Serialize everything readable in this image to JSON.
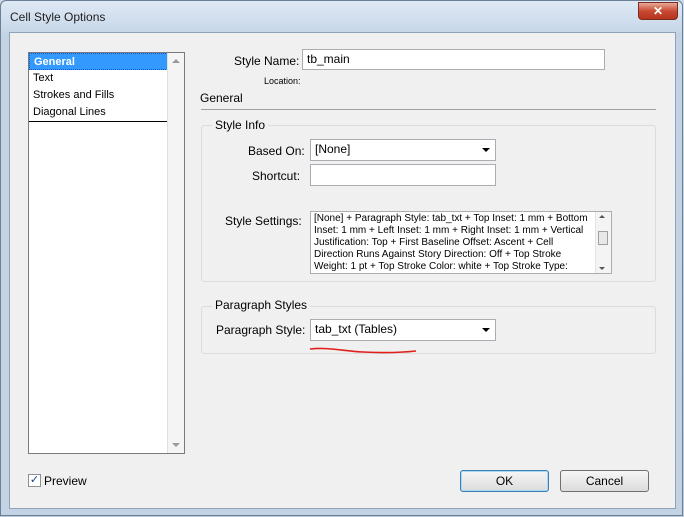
{
  "window": {
    "title": "Cell Style Options",
    "close_glyph": "✕"
  },
  "categories": [
    {
      "label": "General",
      "selected": true
    },
    {
      "label": "Text",
      "selected": false
    },
    {
      "label": "Strokes and Fills",
      "selected": false
    },
    {
      "label": "Diagonal Lines",
      "selected": false
    }
  ],
  "style_name": {
    "label": "Style Name:",
    "value": "tb_main"
  },
  "location": {
    "label": "Location:"
  },
  "section_title": "General",
  "style_info": {
    "title": "Style Info",
    "based_on_label": "Based On:",
    "based_on_value": "[None]",
    "shortcut_label": "Shortcut:",
    "shortcut_value": "",
    "settings_label": "Style Settings:",
    "settings_text": "[None] + Paragraph Style: tab_txt + Top Inset: 1 mm + Bottom Inset: 1 mm + Left Inset: 1 mm + Right Inset: 1 mm + Vertical Justification: Top + First Baseline Offset: Ascent + Cell Direction Runs Against Story Direction: Off + Top Stroke Weight: 1 pt + Top Stroke Color: white + Top Stroke Type: Solid + Top Stroke"
  },
  "paragraph_styles": {
    "title": "Paragraph Styles",
    "label": "Paragraph Style:",
    "value": "tab_txt (Tables)"
  },
  "preview": {
    "label": "Preview",
    "checked": true,
    "check_glyph": "✓"
  },
  "buttons": {
    "ok": "OK",
    "cancel": "Cancel"
  },
  "colors": {
    "selection": "#3399ff",
    "annotation": "#e0201c"
  }
}
